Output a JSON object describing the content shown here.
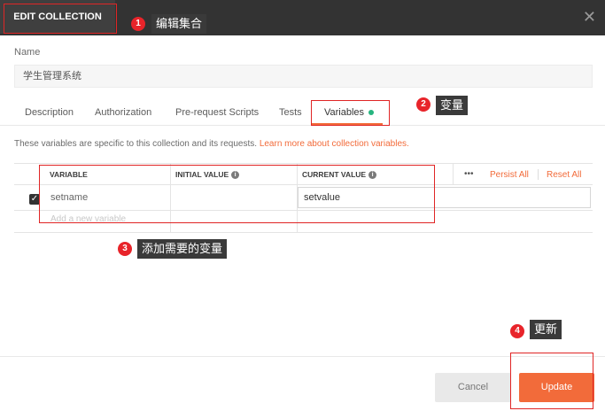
{
  "header": {
    "title": "EDIT COLLECTION",
    "close_icon": "close-icon"
  },
  "form": {
    "name_label": "Name",
    "name_value": "学生管理系统"
  },
  "tabs": [
    {
      "label": "Description"
    },
    {
      "label": "Authorization"
    },
    {
      "label": "Pre-request Scripts"
    },
    {
      "label": "Tests"
    },
    {
      "label": "Variables",
      "active": true
    }
  ],
  "variables": {
    "description": "These variables are specific to this collection and its requests. ",
    "learn_more": "Learn more about collection variables.",
    "columns": [
      "VARIABLE",
      "INITIAL VALUE",
      "CURRENT VALUE"
    ],
    "more": "•••",
    "persist_all": "Persist All",
    "reset_all": "Reset All",
    "rows": [
      {
        "checked": true,
        "variable": "setname",
        "initial_value": "",
        "current_value": "setvalue"
      }
    ],
    "add_placeholder": "Add a new variable"
  },
  "annotations": [
    {
      "number": "1",
      "text": "编辑集合"
    },
    {
      "number": "2",
      "text": "变量"
    },
    {
      "number": "3",
      "text": "添加需要的变量"
    },
    {
      "number": "4",
      "text": "更新"
    }
  ],
  "footer": {
    "cancel_label": "Cancel",
    "update_label": "Update"
  },
  "colors": {
    "accent": "#f26b3a",
    "header_bg": "#333333",
    "annotation_red": "#e02525",
    "active_dot": "#26b47f"
  }
}
